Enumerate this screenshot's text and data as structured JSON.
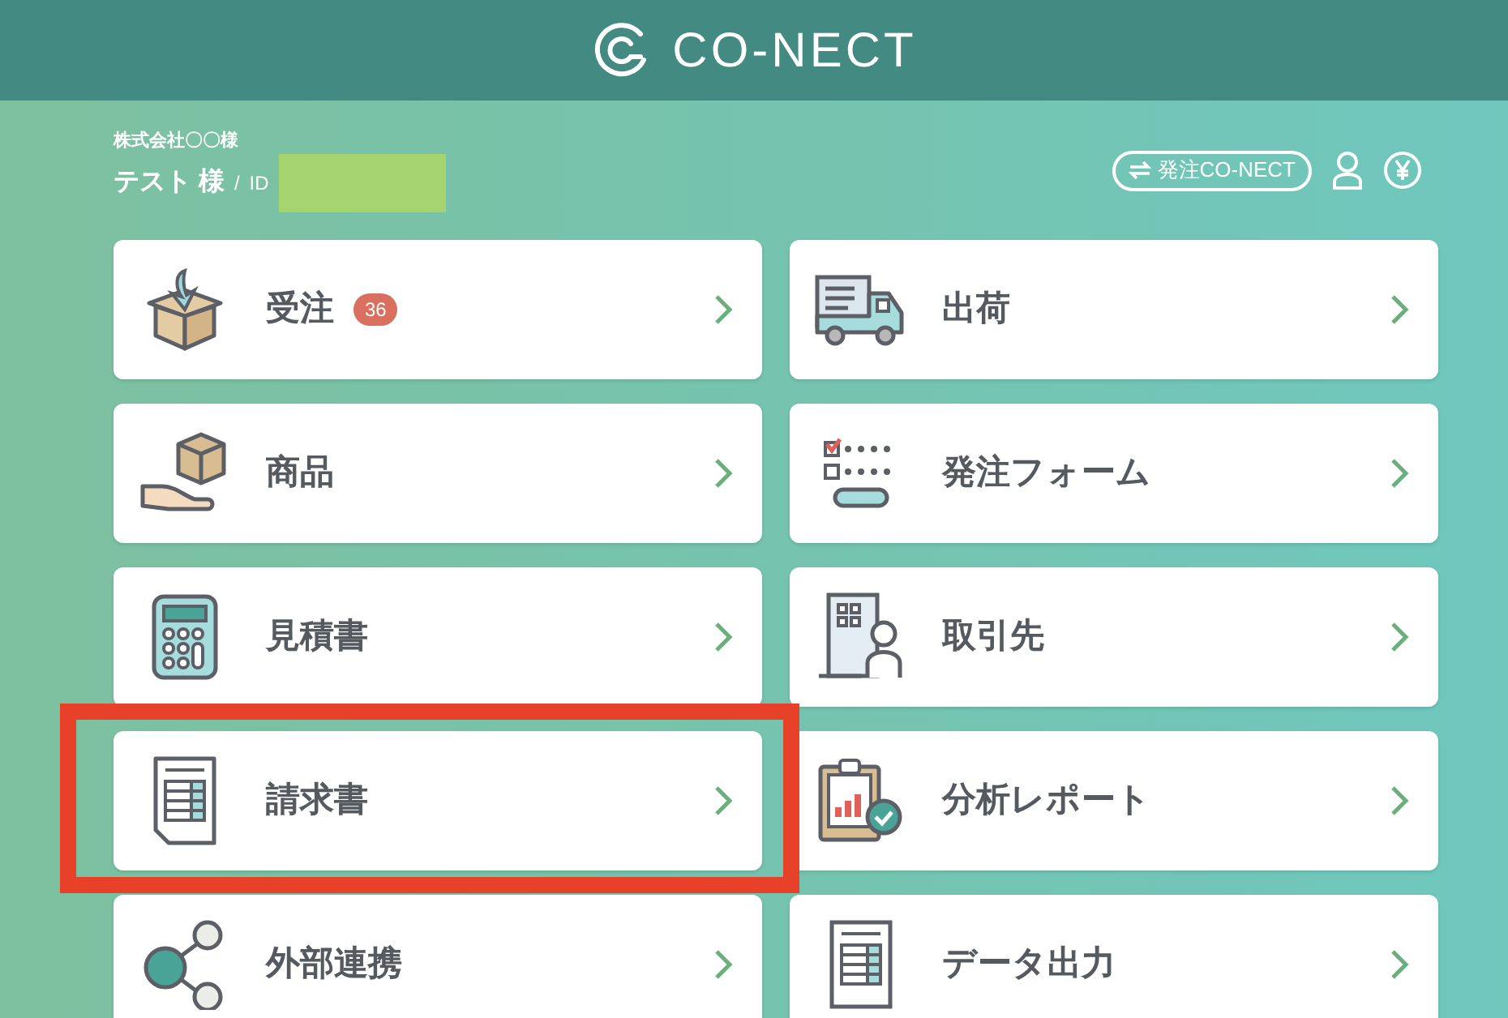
{
  "header": {
    "logo_text": "CO-NECT"
  },
  "user": {
    "company": "株式会社〇〇様",
    "name": "テスト 様",
    "separator": "/",
    "id_label": "ID"
  },
  "actions": {
    "switch_button": "発注CO-NECT"
  },
  "menu": [
    {
      "label": "受注",
      "badge": "36",
      "highlighted": false
    },
    {
      "label": "出荷",
      "highlighted": false
    },
    {
      "label": "商品",
      "highlighted": false
    },
    {
      "label": "発注フォーム",
      "highlighted": false
    },
    {
      "label": "見積書",
      "highlighted": false
    },
    {
      "label": "取引先",
      "highlighted": false
    },
    {
      "label": "請求書",
      "highlighted": true
    },
    {
      "label": "分析レポート",
      "highlighted": false
    },
    {
      "label": "外部連携",
      "highlighted": false
    },
    {
      "label": "データ出力",
      "highlighted": false
    }
  ]
}
